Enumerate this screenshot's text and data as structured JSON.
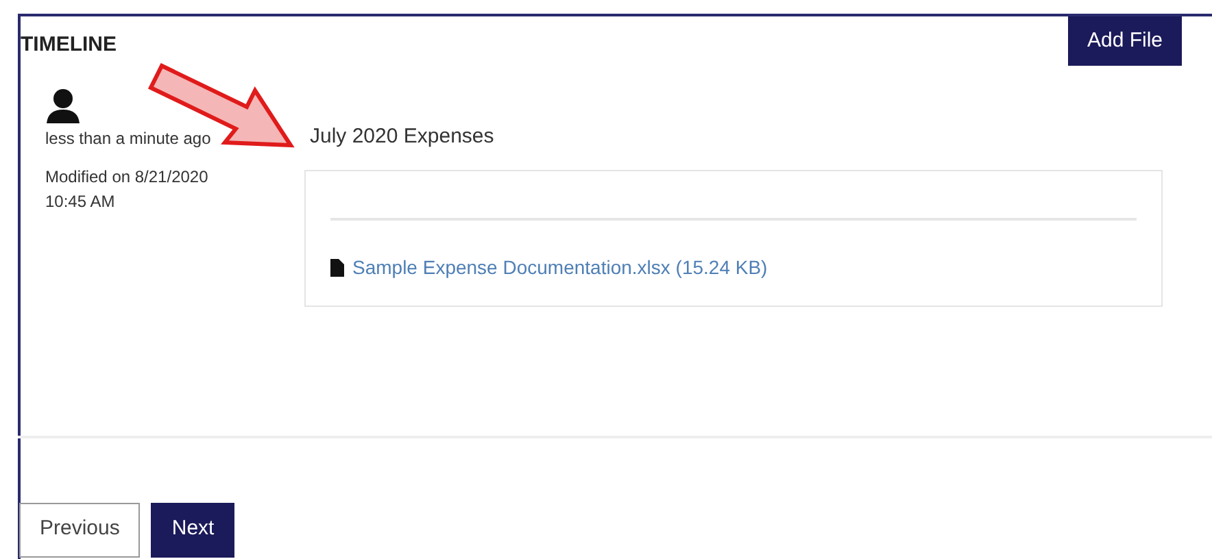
{
  "header": {
    "title": "TIMELINE",
    "action": "Add File"
  },
  "entry": {
    "time": "less than a minute ago",
    "modified": "Modified on 8/21/2020",
    "modified_time": "10:45 AM",
    "title": "July 2020 Expenses",
    "attachment": "Sample Expense Documentation.xlsx (15.24 KB)"
  },
  "buttons": [
    {
      "label": "Previous",
      "kind": "secondary"
    },
    {
      "label": "Next",
      "kind": "primary"
    }
  ]
}
